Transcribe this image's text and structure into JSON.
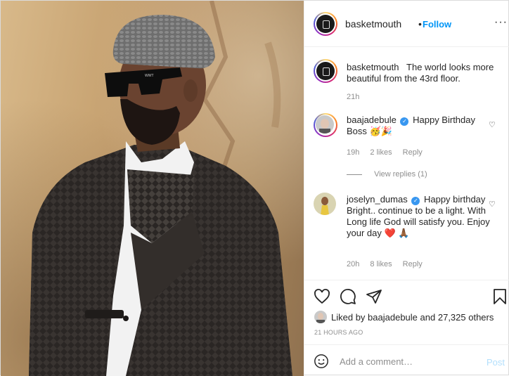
{
  "header": {
    "username": "basketmouth",
    "separator": "•",
    "follow_label": "Follow",
    "more_label": "···"
  },
  "caption": {
    "username": "basketmouth",
    "text": "The world looks more beautiful from the 43rd floor.",
    "time": "21h"
  },
  "comments": [
    {
      "username": "baajadebule",
      "verified": true,
      "text": "Happy Birthday Boss 🥳🎉",
      "time": "19h",
      "likes": "2 likes",
      "reply_label": "Reply",
      "view_replies": "View replies (1)"
    },
    {
      "username": "joselyn_dumas",
      "verified": true,
      "text": "Happy birthday Bright.. continue to be a light. With Long life God will satisfy you. Enjoy your day ❤️ 🙏🏾",
      "time": "20h",
      "likes": "8 likes",
      "reply_label": "Reply"
    }
  ],
  "likes": {
    "prefix": "Liked by",
    "user": "baajadebule",
    "conj": "and",
    "others": "27,325 others"
  },
  "timestamp": "21 HOURS AGO",
  "add_comment": {
    "placeholder": "Add a comment…",
    "post_label": "Post"
  },
  "colors": {
    "follow": "#0095f6",
    "verified": "#3897f0",
    "muted": "#8e8e8e",
    "post_disabled": "#b2dffc"
  }
}
